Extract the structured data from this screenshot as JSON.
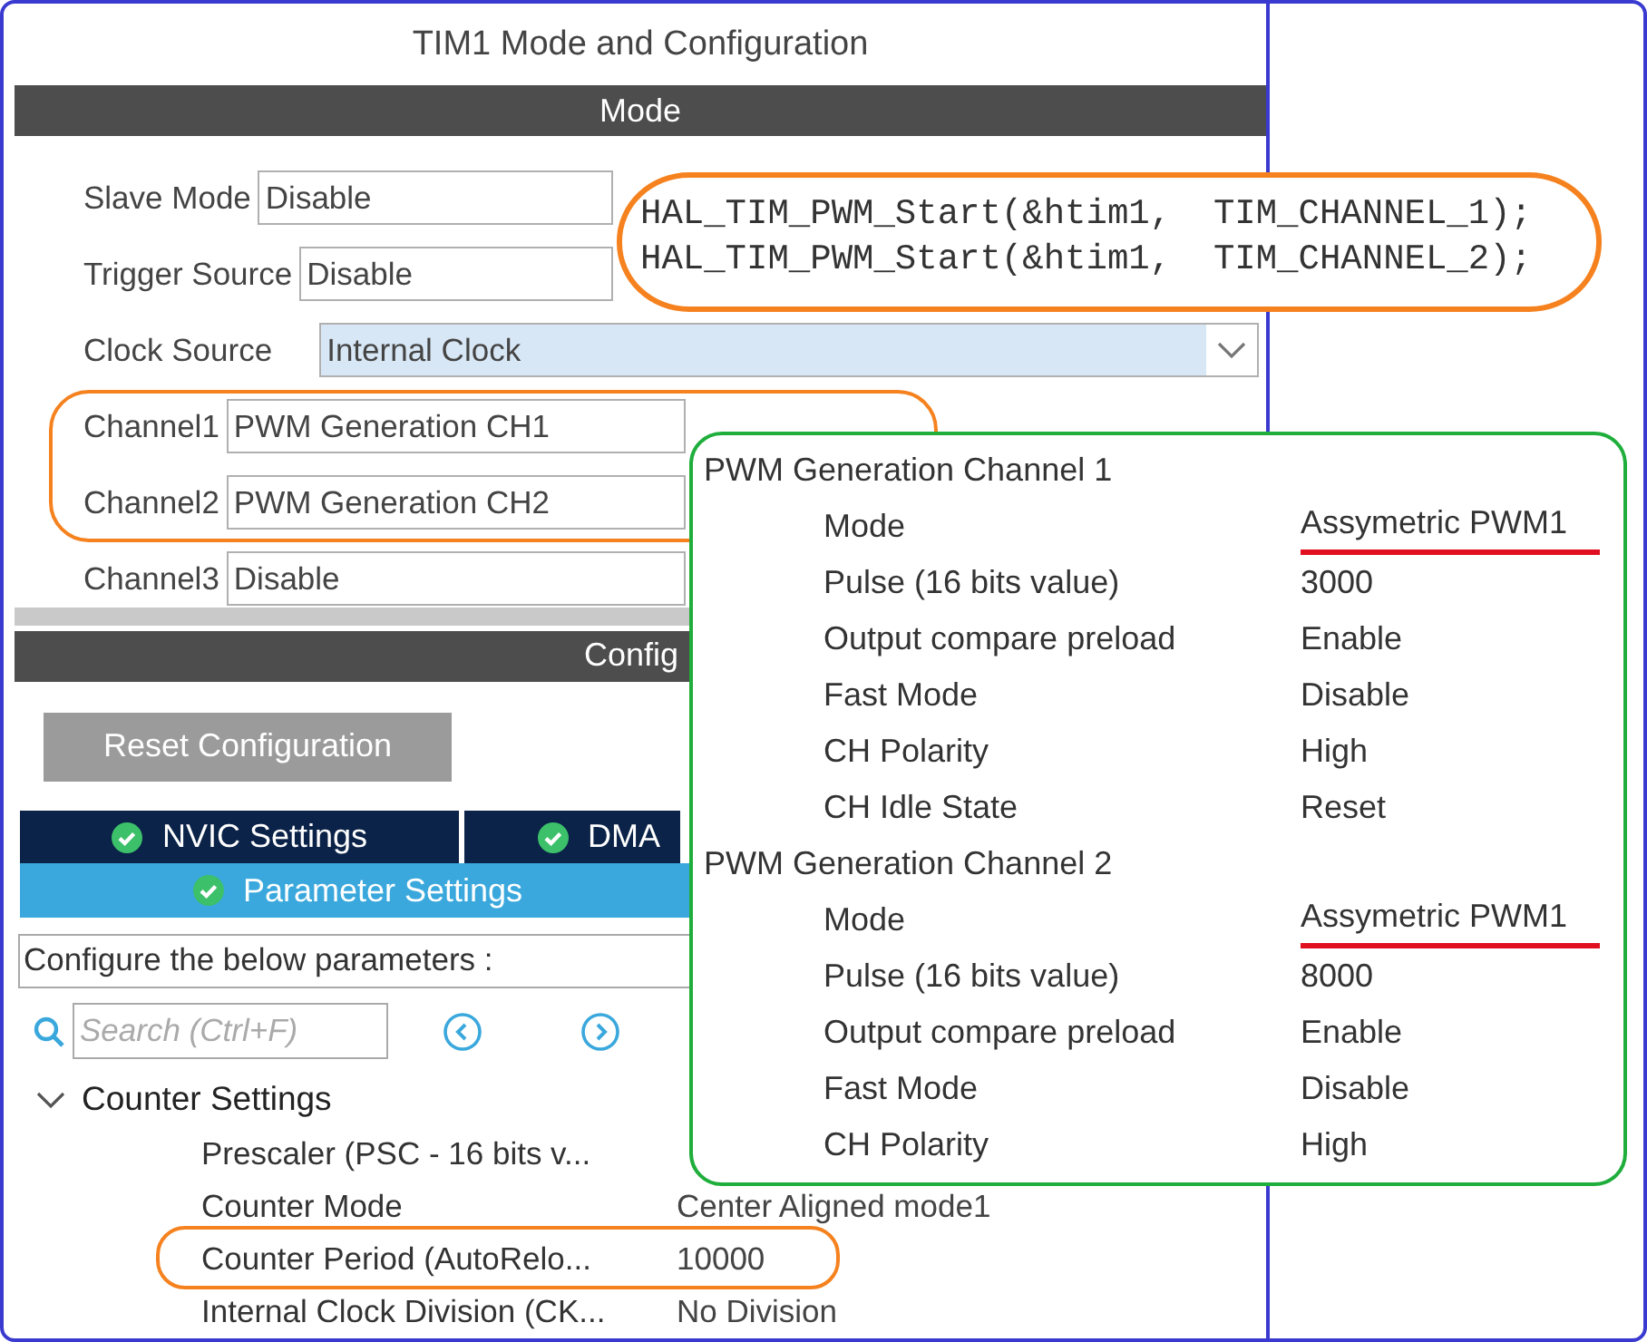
{
  "window": {
    "title": "TIM1 Mode and Configuration"
  },
  "mode_section": {
    "title": "Mode",
    "fields": [
      {
        "label": "Slave Mode",
        "value": "Disable",
        "focused": false,
        "circled": false
      },
      {
        "label": "Trigger Source",
        "value": "Disable",
        "focused": false,
        "circled": false
      },
      {
        "label": "Clock Source",
        "value": "Internal Clock",
        "focused": true,
        "circled": false
      },
      {
        "label": "Channel1",
        "value": "PWM Generation CH1",
        "focused": false,
        "circled": true
      },
      {
        "label": "Channel2",
        "value": "PWM Generation CH2",
        "focused": false,
        "circled": true
      },
      {
        "label": "Channel3",
        "value": "Disable",
        "focused": false,
        "circled": false
      }
    ]
  },
  "configuration_section": {
    "title": "Config",
    "reset_button": "Reset Configuration",
    "tabs": [
      {
        "label": "NVIC Settings",
        "selected": false
      },
      {
        "label": "DMA",
        "selected": false
      },
      {
        "label": "Parameter Settings",
        "selected": true
      }
    ],
    "hint": "Configure the below parameters :",
    "search": {
      "placeholder": "Search (Ctrl+F)"
    },
    "groups": [
      {
        "title": "Counter Settings",
        "expanded": true,
        "params": [
          {
            "label": "Prescaler (PSC - 16 bits v...",
            "circled": false
          },
          {
            "label": "Counter Mode",
            "value": "Center Aligned mode1",
            "circled": false
          },
          {
            "label": "Counter Period (AutoRelo...",
            "value": "10000",
            "circled": true
          },
          {
            "label": "Internal Clock Division (CK...",
            "value": "No Division",
            "circled": false
          }
        ]
      }
    ]
  },
  "code_note": {
    "lines": [
      "HAL_TIM_PWM_Start(&htim1,  TIM_CHANNEL_1);",
      "HAL_TIM_PWM_Start(&htim1,  TIM_CHANNEL_2);"
    ]
  },
  "channel_details": [
    {
      "title": "PWM Generation Channel 1",
      "params": [
        {
          "label": "Mode",
          "value": "Assymetric PWM1",
          "underlined": true
        },
        {
          "label": "Pulse (16 bits value)",
          "value": "3000",
          "underlined": false
        },
        {
          "label": "Output compare preload",
          "value": "Enable",
          "underlined": false
        },
        {
          "label": "Fast Mode",
          "value": "Disable",
          "underlined": false
        },
        {
          "label": "CH Polarity",
          "value": "High",
          "underlined": false
        },
        {
          "label": "CH Idle State",
          "value": "Reset",
          "underlined": false
        }
      ]
    },
    {
      "title": "PWM Generation Channel 2",
      "params": [
        {
          "label": "Mode",
          "value": "Assymetric PWM1",
          "underlined": true
        },
        {
          "label": "Pulse (16 bits value)",
          "value": "8000",
          "underlined": false
        },
        {
          "label": "Output compare preload",
          "value": "Enable",
          "underlined": false
        },
        {
          "label": "Fast Mode",
          "value": "Disable",
          "underlined": false
        },
        {
          "label": "CH Polarity",
          "value": "High",
          "underlined": false
        }
      ]
    }
  ]
}
